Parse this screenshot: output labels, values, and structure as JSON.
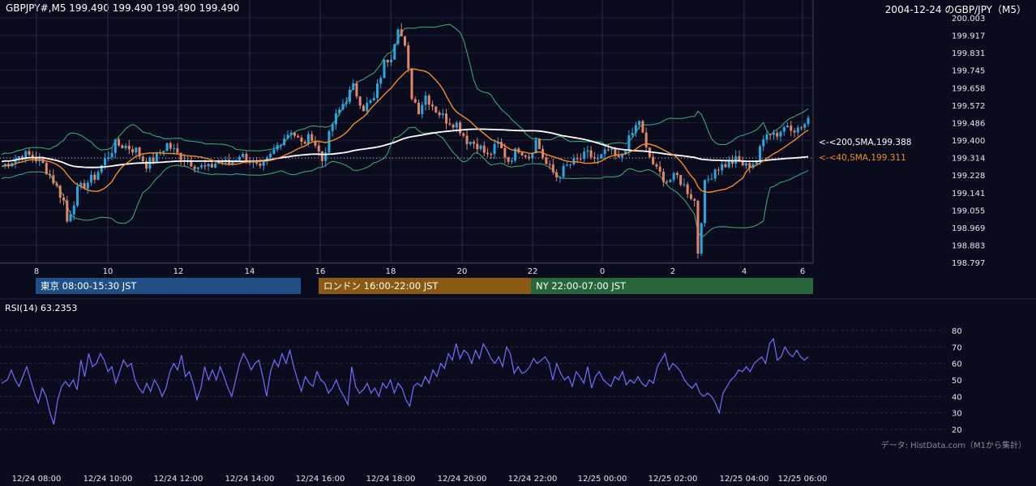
{
  "header": {
    "symbol_info": "GBPJPY#,M5 199.490 199.490 199.490 199.490",
    "title": "2004-12-24 のGBP/JPY（M5）"
  },
  "sessions": [
    {
      "label": "東京 08:00-15:30 JST",
      "color": "#1f4f86"
    },
    {
      "label": "ロンドン 16:00-22:00 JST",
      "color": "#8a5a14"
    },
    {
      "label": "NY 22:00-07:00 JST",
      "color": "#27663d"
    }
  ],
  "rsi_panel": {
    "label": "RSI(14) 63.2353"
  },
  "credit": "データ: HistData.com（M1から集計）",
  "colors": {
    "background": "#0b0b1e",
    "bull": "#29a8e0",
    "bear": "#e0876a",
    "sma200": "#ffffff",
    "sma40": "#f28c28",
    "bollinger": "#3cb371",
    "rsi": "#6f6fff"
  },
  "chart_data": [
    {
      "type": "candlestick",
      "y_ticks": [
        "200.003",
        "199.917",
        "199.831",
        "199.745",
        "199.658",
        "199.572",
        "199.486",
        "199.400",
        "199.314",
        "199.228",
        "199.141",
        "199.055",
        "198.969",
        "198.883",
        "198.797"
      ],
      "ylim": [
        198.797,
        200.003
      ],
      "x_ticks": [
        "8",
        "10",
        "12",
        "14",
        "16",
        "18",
        "20",
        "22",
        "0",
        "2",
        "4",
        "6"
      ],
      "current_price": 199.49,
      "ma_labels": [
        {
          "text": "<-<200,SMA,199.388",
          "value": 199.388,
          "color": "#ffffff"
        },
        {
          "text": "<-<40,SMA,199.311",
          "value": 199.311,
          "color": "#f28c28"
        }
      ],
      "close_path": [
        [
          0,
          199.27
        ],
        [
          3,
          199.3
        ],
        [
          6,
          199.33
        ],
        [
          9,
          199.32
        ],
        [
          12,
          199.28
        ],
        [
          15,
          199.2
        ],
        [
          18,
          199.1
        ],
        [
          19,
          199.0
        ],
        [
          20,
          199.05
        ],
        [
          22,
          199.15
        ],
        [
          24,
          199.18
        ],
        [
          27,
          199.22
        ],
        [
          30,
          199.3
        ],
        [
          33,
          199.38
        ],
        [
          36,
          199.37
        ],
        [
          39,
          199.35
        ],
        [
          42,
          199.28
        ],
        [
          45,
          199.32
        ],
        [
          48,
          199.38
        ],
        [
          51,
          199.33
        ],
        [
          54,
          199.3
        ],
        [
          57,
          199.27
        ],
        [
          60,
          199.26
        ],
        [
          63,
          199.3
        ],
        [
          66,
          199.28
        ],
        [
          69,
          199.33
        ],
        [
          72,
          199.3
        ],
        [
          75,
          199.25
        ],
        [
          78,
          199.32
        ],
        [
          81,
          199.4
        ],
        [
          84,
          199.45
        ],
        [
          87,
          199.38
        ],
        [
          90,
          199.42
        ],
        [
          93,
          199.3
        ],
        [
          96,
          199.48
        ],
        [
          99,
          199.58
        ],
        [
          102,
          199.66
        ],
        [
          105,
          199.56
        ],
        [
          108,
          199.6
        ],
        [
          111,
          199.78
        ],
        [
          113,
          199.82
        ],
        [
          115,
          199.97
        ],
        [
          117,
          199.85
        ],
        [
          119,
          199.62
        ],
        [
          121,
          199.55
        ],
        [
          123,
          199.62
        ],
        [
          126,
          199.55
        ],
        [
          129,
          199.5
        ],
        [
          132,
          199.48
        ],
        [
          135,
          199.4
        ],
        [
          138,
          199.38
        ],
        [
          141,
          199.32
        ],
        [
          144,
          199.38
        ],
        [
          147,
          199.3
        ],
        [
          150,
          199.36
        ],
        [
          153,
          199.32
        ],
        [
          155,
          199.4
        ],
        [
          158,
          199.28
        ],
        [
          161,
          199.22
        ],
        [
          164,
          199.27
        ],
        [
          167,
          199.3
        ],
        [
          170,
          199.33
        ],
        [
          173,
          199.3
        ],
        [
          176,
          199.35
        ],
        [
          179,
          199.3
        ],
        [
          182,
          199.4
        ],
        [
          185,
          199.5
        ],
        [
          187,
          199.35
        ],
        [
          190,
          199.25
        ],
        [
          193,
          199.2
        ],
        [
          196,
          199.22
        ],
        [
          199,
          199.15
        ],
        [
          201,
          199.1
        ],
        [
          202,
          198.85
        ],
        [
          204,
          199.18
        ],
        [
          207,
          199.26
        ],
        [
          210,
          199.28
        ],
        [
          213,
          199.3
        ],
        [
          216,
          199.27
        ],
        [
          219,
          199.3
        ],
        [
          222,
          199.45
        ],
        [
          225,
          199.43
        ],
        [
          228,
          199.48
        ],
        [
          231,
          199.45
        ],
        [
          234,
          199.49
        ]
      ],
      "close_points_total": 234
    },
    {
      "type": "line",
      "name": "RSI(14)",
      "y_ticks": [
        "80",
        "70",
        "60",
        "50",
        "40",
        "30",
        "20"
      ],
      "ylim": [
        20,
        80
      ],
      "x_ticks": [
        "12/24 08:00",
        "12/24 10:00",
        "12/24 12:00",
        "12/24 14:00",
        "12/24 16:00",
        "12/24 18:00",
        "12/24 20:00",
        "12/24 22:00",
        "12/25 00:00",
        "12/25 02:00",
        "12/25 04:00",
        "12/25 06:00"
      ],
      "values": [
        [
          0,
          48
        ],
        [
          3,
          50
        ],
        [
          5,
          56
        ],
        [
          7,
          50
        ],
        [
          9,
          46
        ],
        [
          11,
          52
        ],
        [
          13,
          58
        ],
        [
          15,
          50
        ],
        [
          17,
          42
        ],
        [
          19,
          36
        ],
        [
          21,
          45
        ],
        [
          23,
          40
        ],
        [
          25,
          30
        ],
        [
          27,
          23
        ],
        [
          29,
          38
        ],
        [
          31,
          46
        ],
        [
          33,
          49
        ],
        [
          35,
          46
        ],
        [
          37,
          50
        ],
        [
          39,
          44
        ],
        [
          41,
          62
        ],
        [
          43,
          52
        ],
        [
          45,
          66
        ],
        [
          47,
          58
        ],
        [
          49,
          60
        ],
        [
          51,
          66
        ],
        [
          53,
          62
        ],
        [
          55,
          55
        ],
        [
          57,
          58
        ],
        [
          59,
          48
        ],
        [
          61,
          55
        ],
        [
          63,
          62
        ],
        [
          65,
          58
        ],
        [
          67,
          60
        ],
        [
          69,
          50
        ],
        [
          71,
          45
        ],
        [
          73,
          42
        ],
        [
          75,
          48
        ],
        [
          77,
          43
        ],
        [
          79,
          50
        ],
        [
          81,
          46
        ],
        [
          83,
          40
        ],
        [
          85,
          45
        ],
        [
          87,
          55
        ],
        [
          89,
          60
        ],
        [
          91,
          56
        ],
        [
          93,
          65
        ],
        [
          95,
          52
        ],
        [
          97,
          55
        ],
        [
          99,
          48
        ],
        [
          101,
          38
        ],
        [
          103,
          45
        ],
        [
          105,
          58
        ],
        [
          107,
          50
        ],
        [
          109,
          56
        ],
        [
          111,
          50
        ],
        [
          113,
          58
        ],
        [
          115,
          52
        ],
        [
          117,
          45
        ],
        [
          119,
          40
        ],
        [
          121,
          50
        ],
        [
          123,
          60
        ],
        [
          125,
          66
        ],
        [
          127,
          62
        ],
        [
          129,
          56
        ],
        [
          131,
          60
        ],
        [
          133,
          62
        ],
        [
          135,
          52
        ],
        [
          137,
          40
        ],
        [
          139,
          55
        ],
        [
          141,
          62
        ],
        [
          143,
          58
        ],
        [
          145,
          66
        ],
        [
          147,
          60
        ],
        [
          149,
          68
        ],
        [
          151,
          58
        ],
        [
          153,
          50
        ],
        [
          155,
          43
        ],
        [
          157,
          52
        ],
        [
          159,
          48
        ],
        [
          161,
          46
        ],
        [
          163,
          55
        ],
        [
          165,
          50
        ],
        [
          167,
          48
        ],
        [
          169,
          42
        ],
        [
          171,
          45
        ],
        [
          173,
          50
        ],
        [
          175,
          44
        ],
        [
          177,
          40
        ],
        [
          179,
          35
        ],
        [
          181,
          58
        ],
        [
          183,
          46
        ],
        [
          185,
          42
        ],
        [
          187,
          44
        ],
        [
          189,
          48
        ],
        [
          191,
          42
        ],
        [
          193,
          45
        ],
        [
          195,
          40
        ],
        [
          197,
          48
        ],
        [
          199,
          45
        ],
        [
          201,
          50
        ],
        [
          203,
          42
        ],
        [
          205,
          48
        ],
        [
          207,
          45
        ],
        [
          209,
          38
        ],
        [
          211,
          34
        ],
        [
          213,
          46
        ],
        [
          215,
          48
        ],
        [
          217,
          46
        ],
        [
          219,
          52
        ],
        [
          221,
          48
        ],
        [
          223,
          56
        ],
        [
          225,
          52
        ],
        [
          227,
          60
        ],
        [
          229,
          57
        ],
        [
          231,
          66
        ],
        [
          233,
          62
        ],
        [
          235,
          72
        ],
        [
          237,
          63
        ],
        [
          239,
          68
        ],
        [
          241,
          66
        ],
        [
          243,
          60
        ],
        [
          245,
          68
        ],
        [
          247,
          63
        ],
        [
          249,
          72
        ],
        [
          251,
          68
        ],
        [
          253,
          63
        ],
        [
          255,
          60
        ],
        [
          257,
          64
        ],
        [
          259,
          58
        ],
        [
          261,
          70
        ],
        [
          263,
          66
        ],
        [
          265,
          54
        ],
        [
          267,
          58
        ],
        [
          269,
          54
        ],
        [
          271,
          55
        ],
        [
          273,
          58
        ],
        [
          275,
          63
        ],
        [
          277,
          60
        ],
        [
          279,
          62
        ],
        [
          281,
          64
        ],
        [
          283,
          60
        ],
        [
          285,
          50
        ],
        [
          287,
          60
        ],
        [
          289,
          54
        ],
        [
          291,
          50
        ],
        [
          293,
          52
        ],
        [
          295,
          46
        ],
        [
          297,
          55
        ],
        [
          299,
          52
        ],
        [
          301,
          48
        ],
        [
          303,
          58
        ],
        [
          305,
          45
        ],
        [
          307,
          52
        ],
        [
          309,
          55
        ],
        [
          311,
          50
        ],
        [
          313,
          48
        ],
        [
          315,
          46
        ],
        [
          317,
          52
        ],
        [
          319,
          50
        ],
        [
          321,
          55
        ],
        [
          323,
          47
        ],
        [
          325,
          50
        ],
        [
          327,
          48
        ],
        [
          329,
          52
        ],
        [
          331,
          48
        ],
        [
          333,
          46
        ],
        [
          335,
          50
        ],
        [
          337,
          48
        ],
        [
          339,
          58
        ],
        [
          341,
          62
        ],
        [
          343,
          66
        ],
        [
          345,
          56
        ],
        [
          347,
          60
        ],
        [
          349,
          58
        ],
        [
          351,
          55
        ],
        [
          353,
          50
        ],
        [
          355,
          47
        ],
        [
          357,
          45
        ],
        [
          359,
          48
        ],
        [
          361,
          42
        ],
        [
          363,
          40
        ],
        [
          365,
          42
        ],
        [
          367,
          40
        ],
        [
          369,
          36
        ],
        [
          371,
          30
        ],
        [
          373,
          42
        ],
        [
          375,
          46
        ],
        [
          377,
          50
        ],
        [
          379,
          52
        ],
        [
          381,
          56
        ],
        [
          383,
          55
        ],
        [
          385,
          58
        ],
        [
          387,
          55
        ],
        [
          389,
          60
        ],
        [
          391,
          62
        ],
        [
          393,
          64
        ],
        [
          395,
          60
        ],
        [
          397,
          72
        ],
        [
          399,
          75
        ],
        [
          401,
          62
        ],
        [
          403,
          64
        ],
        [
          405,
          70
        ],
        [
          407,
          66
        ],
        [
          409,
          64
        ],
        [
          411,
          68
        ],
        [
          413,
          64
        ],
        [
          415,
          62
        ],
        [
          417,
          64
        ]
      ]
    }
  ]
}
